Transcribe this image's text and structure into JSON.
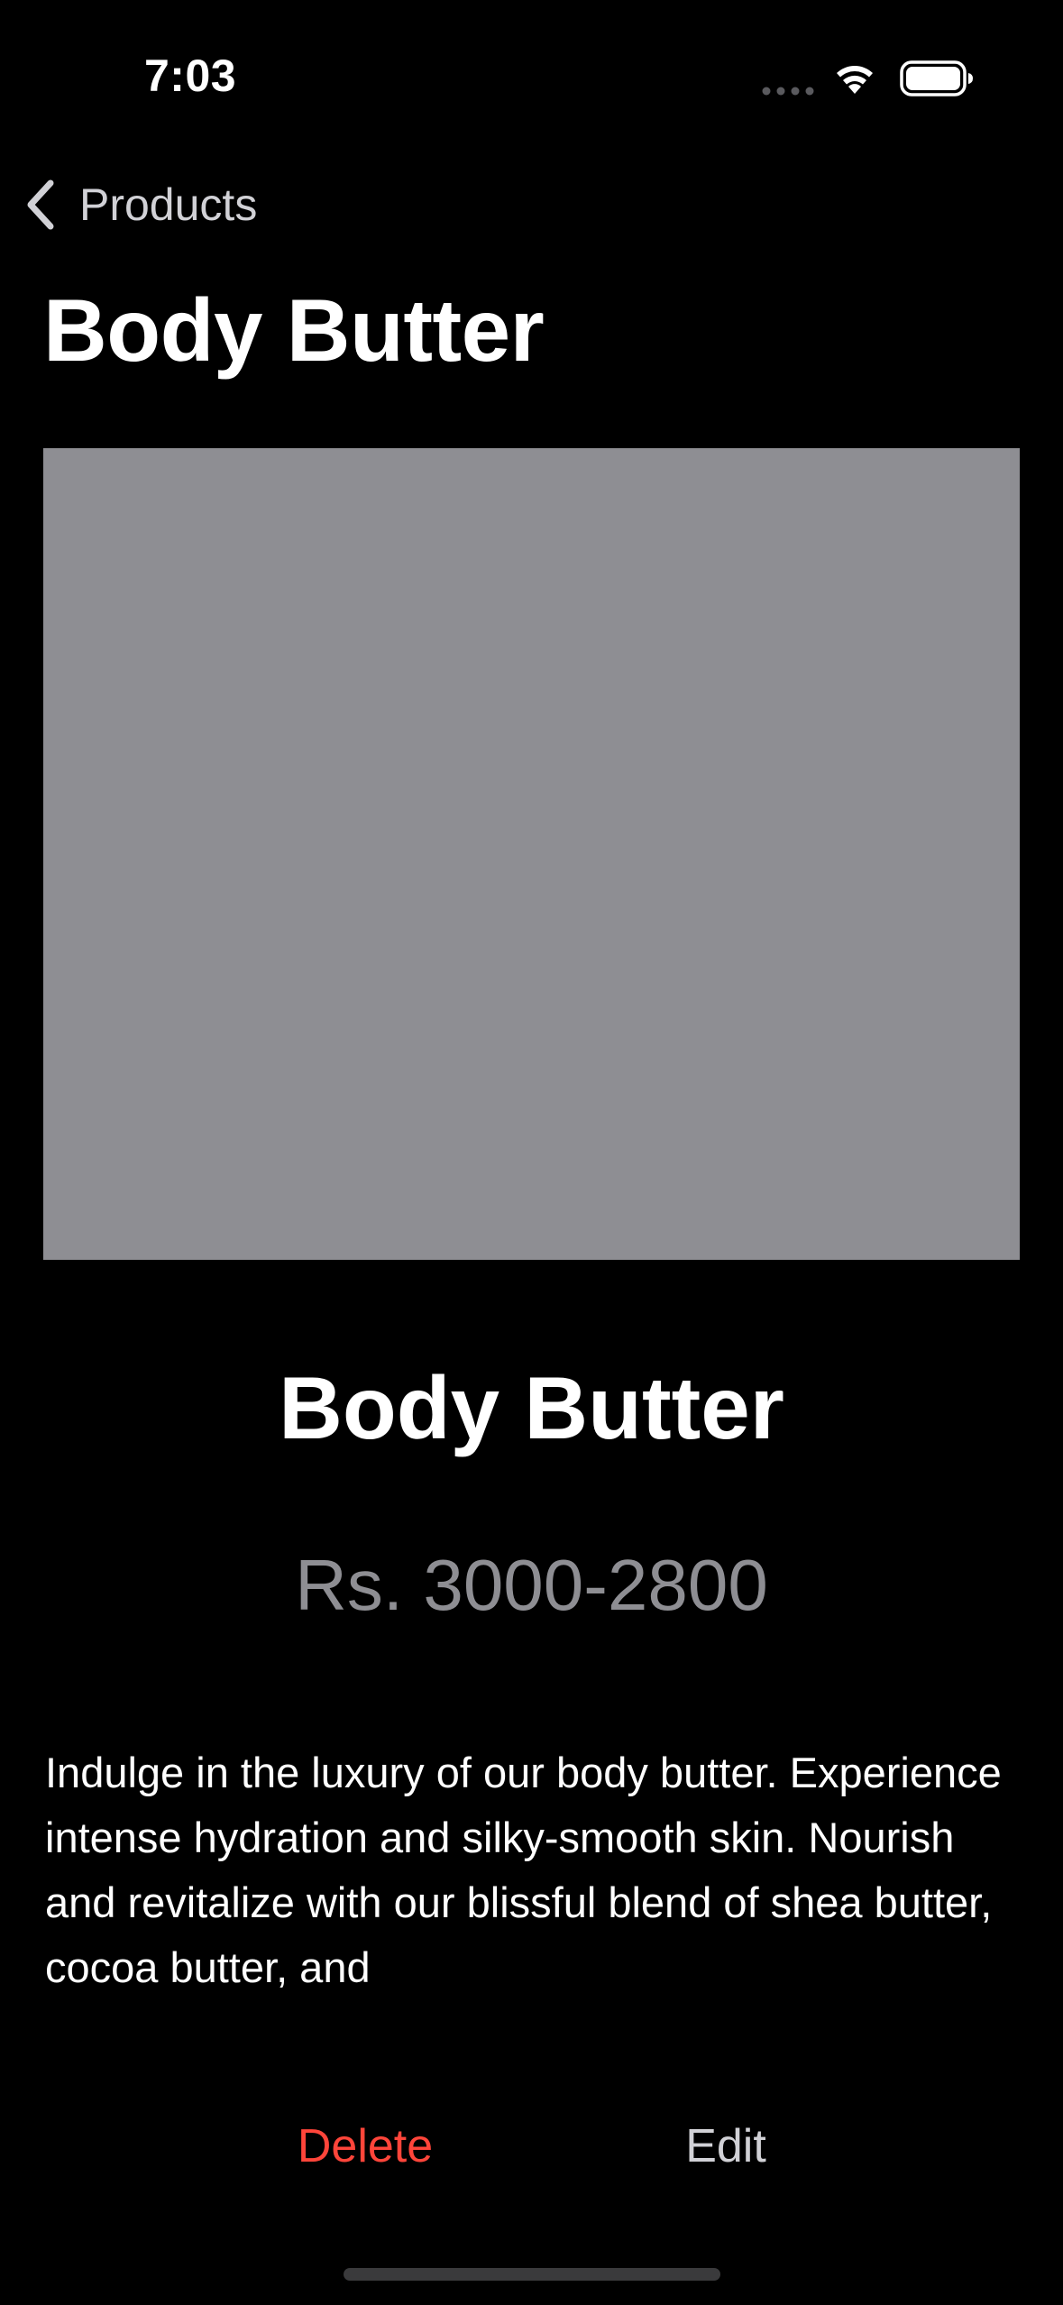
{
  "status_bar": {
    "time": "7:03",
    "icons": [
      "signal-dots-icon",
      "wifi-icon",
      "battery-icon"
    ]
  },
  "nav": {
    "back_label": "Products",
    "back_icon": "chevron-left-icon"
  },
  "page": {
    "title": "Body Butter"
  },
  "product": {
    "image_placeholder_color": "#8e8e93",
    "name": "Body Butter",
    "price": "Rs. 3000-2800",
    "description": "Indulge in the luxury of our body butter. Experience intense hydration and silky-smooth skin. Nourish and revitalize with our blissful blend of shea butter, cocoa butter, and"
  },
  "actions": {
    "delete_label": "Delete",
    "edit_label": "Edit"
  },
  "colors": {
    "background": "#000000",
    "destructive": "#ff453a",
    "secondary_text": "#8e8e93",
    "image_placeholder": "#8e8e93"
  }
}
